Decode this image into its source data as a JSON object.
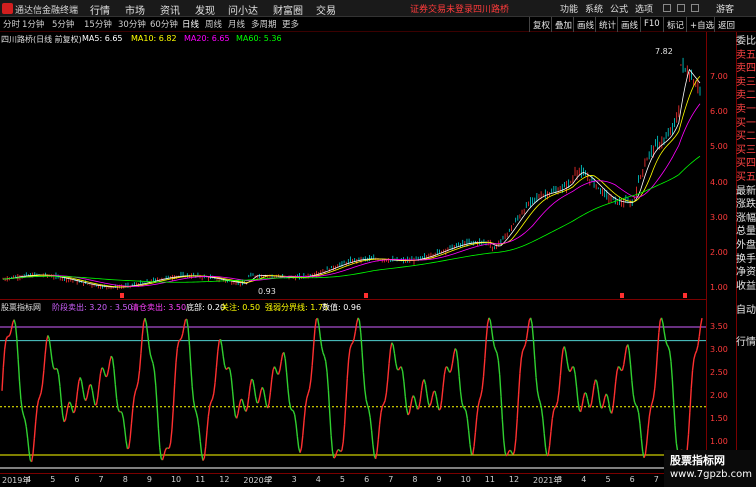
{
  "menubar": {
    "app_title": "通达信金融终端",
    "items": [
      "行情",
      "市场",
      "资讯",
      "发现",
      "问小达",
      "财富圈",
      "交易"
    ],
    "login_alert": "证券交易未登录",
    "stock_link": "四川路桥",
    "right_items": [
      "功能",
      "系统",
      "公式",
      "选项"
    ],
    "guest": "游客"
  },
  "toolbar": {
    "periods": [
      "分时",
      "1分钟",
      "5分钟",
      "15分钟",
      "30分钟",
      "60分钟",
      "日线",
      "周线",
      "月线",
      "多周期",
      "更多"
    ],
    "active_period": "日线",
    "buttons": [
      "复权",
      "叠加",
      "画线",
      "统计",
      "画线",
      "F10",
      "标记",
      "+自选",
      "返回"
    ]
  },
  "main_chart": {
    "title": "四川路桥(日线 前复权)",
    "ma": [
      {
        "label": "MA5: 6.65",
        "color": "#ffffff"
      },
      {
        "label": "MA10: 6.82",
        "color": "#ffff00"
      },
      {
        "label": "MA20: 6.65",
        "color": "#ff00ff"
      },
      {
        "label": "MA60: 5.36",
        "color": "#00ff00"
      }
    ],
    "high_label": "7.82",
    "low_label": "0.93",
    "price_ticks": [
      "7.00",
      "6.00",
      "5.00",
      "4.00",
      "3.00",
      "2.00",
      "1.00"
    ]
  },
  "sidebar": {
    "items": [
      "委比",
      "卖五",
      "卖四",
      "卖三",
      "卖二",
      "卖一",
      "买一",
      "买二",
      "买三",
      "买四",
      "买五",
      "最新",
      "涨跌",
      "涨幅",
      "总量",
      "外盘",
      "换手",
      "净资",
      "收益"
    ]
  },
  "sub_chart": {
    "title": "股票指标网",
    "labels": [
      {
        "label": "阶段卖出: 3.20 : 3.50",
        "color": "#d060ff"
      },
      {
        "label": "清仓卖出: 3.50",
        "color": "#ff40ff"
      },
      {
        "label": "底部: 0.20",
        "color": "#ffffff"
      },
      {
        "label": "关注: 0.50",
        "color": "#ffff00"
      },
      {
        "label": "强弱分界线: 1.75",
        "color": "#ffff00"
      },
      {
        "label": "数值: 0.96",
        "color": "#ffffff"
      }
    ],
    "ticks": [
      "3.50",
      "3.00",
      "2.50",
      "2.00",
      "1.50",
      "1.00"
    ],
    "side_items": [
      "自动",
      "行情"
    ]
  },
  "date_axis": {
    "labels": [
      "2019年",
      "4",
      "5",
      "6",
      "7",
      "8",
      "9",
      "10",
      "11",
      "12",
      "2020年",
      "2",
      "3",
      "4",
      "5",
      "6",
      "7",
      "8",
      "9",
      "10",
      "11",
      "12",
      "2021年",
      "3",
      "4",
      "5",
      "6",
      "7",
      "8"
    ]
  },
  "watermark": {
    "title": "股票指标网",
    "url": "www.7gpzb.com"
  },
  "chart_data": {
    "type": "line",
    "x": [
      "2019-03",
      "2019-06",
      "2019-09",
      "2019-12",
      "2020-03",
      "2020-06",
      "2020-09",
      "2020-12",
      "2021-03",
      "2021-05",
      "2021-07",
      "2021-09"
    ],
    "series": [
      {
        "name": "MA60",
        "values": [
          1.35,
          1.2,
          1.15,
          1.3,
          1.5,
          1.8,
          2.0,
          2.2,
          2.5,
          3.4,
          3.8,
          5.36
        ]
      }
    ],
    "ylim": [
      0.9,
      8.0
    ]
  }
}
